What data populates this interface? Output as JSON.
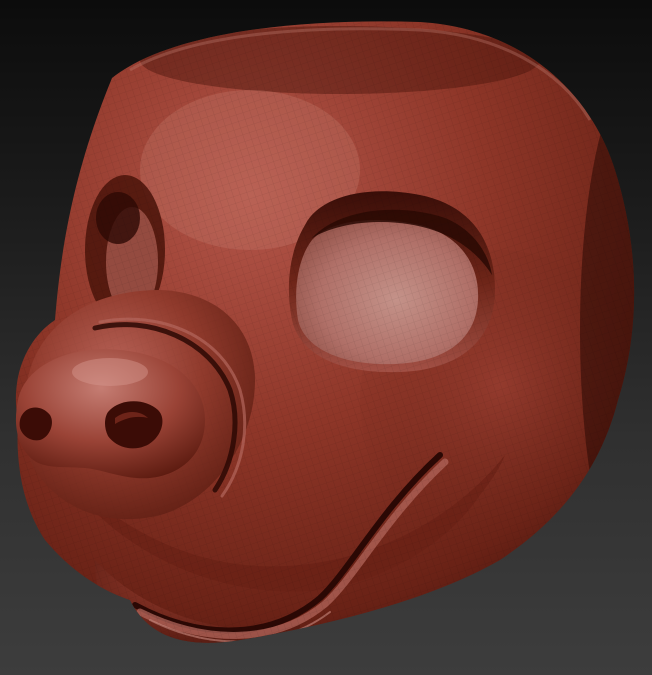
{
  "viewport": {
    "background_top": "#0c0c0c",
    "background_bottom": "#3d3d3d"
  },
  "model": {
    "subject": "sculpted-animal-head",
    "material_base": "#8a3324",
    "material_highlight": "#c98a80",
    "material_shadow": "#2e0c07",
    "wireframe_visible": true
  }
}
